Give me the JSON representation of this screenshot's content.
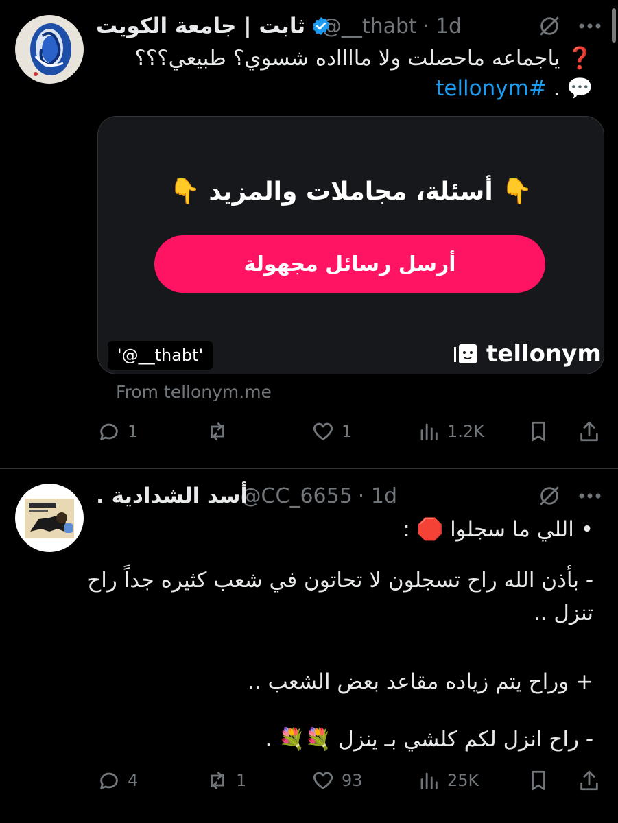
{
  "colors": {
    "background": "#000000",
    "text": "#e7e9ea",
    "muted": "#71767b",
    "link": "#1d9bf0",
    "verified": "#1d9bf0",
    "card_button": "#ff1464"
  },
  "tweets": [
    {
      "display_name": "ثابت | جامعة الكويت",
      "handle": "@__thabt",
      "time": "· 1d",
      "verified": true,
      "line1": "❓ ياجماعه ماحصلت ولا مااااده شسوي؟ طبيعي؟؟؟",
      "line2_emoji": "💬",
      "line2_sep": " . ",
      "hashtag": "#tellonym",
      "card": {
        "title": "👇 أسئلة، مجاملات والمزيد 👇",
        "button": "أرسل رسائل مجهولة",
        "tag": "'@__thabt'",
        "brand": "tellonym"
      },
      "source": "From tellonym.me",
      "replies": "1",
      "retweets": "",
      "likes": "1",
      "views": "1.2K"
    },
    {
      "display_name": "أسد الشدادية .",
      "handle": "@CC_6655",
      "time": "· 1d",
      "verified": false,
      "lines": [
        "• اللي ما سجلوا 🛑 :",
        "- بأذن الله راح تسجلون لا تحاتون في شعب كثيره جداً راح",
        "تنزل ..",
        "+ وراح يتم زياده مقاعد بعض الشعب ..",
        "- راح انزل لكم كلشي بـ ينزل 💐💐 ."
      ],
      "replies": "4",
      "retweets": "1",
      "likes": "93",
      "views": "25K"
    }
  ],
  "icons": {
    "avatar": "abstract-blue-face-avatar",
    "avatar2": "lion-logo-avatar",
    "verified": "verified-badge-icon",
    "grok": "grok-icon",
    "more": "more-icon",
    "reply": "reply-icon",
    "retweet": "retweet-icon",
    "like": "heart-icon",
    "views": "views-icon",
    "bookmark": "bookmark-icon",
    "share": "share-icon"
  }
}
